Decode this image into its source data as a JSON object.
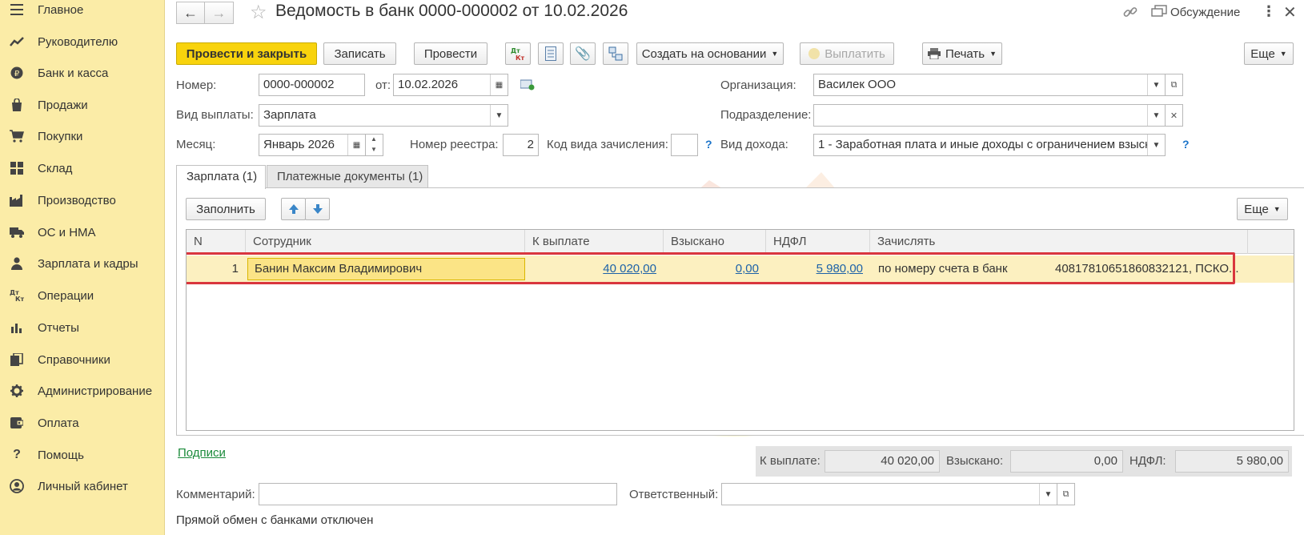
{
  "sidebar": {
    "items": [
      {
        "label": "Главное",
        "icon": "menu-icon"
      },
      {
        "label": "Руководителю",
        "icon": "chart-line-icon"
      },
      {
        "label": "Банк и касса",
        "icon": "coin-icon"
      },
      {
        "label": "Продажи",
        "icon": "shopping-bag-icon"
      },
      {
        "label": "Покупки",
        "icon": "cart-icon"
      },
      {
        "label": "Склад",
        "icon": "warehouse-icon"
      },
      {
        "label": "Производство",
        "icon": "factory-icon"
      },
      {
        "label": "ОС и НМА",
        "icon": "truck-icon"
      },
      {
        "label": "Зарплата и кадры",
        "icon": "person-icon"
      },
      {
        "label": "Операции",
        "icon": "dt-kt-icon"
      },
      {
        "label": "Отчеты",
        "icon": "bar-chart-icon"
      },
      {
        "label": "Справочники",
        "icon": "books-icon"
      },
      {
        "label": "Администрирование",
        "icon": "gear-icon"
      },
      {
        "label": "Оплата",
        "icon": "wallet-icon"
      },
      {
        "label": "Помощь",
        "icon": "question-icon"
      },
      {
        "label": "Личный кабинет",
        "icon": "user-circle-icon"
      }
    ]
  },
  "header": {
    "title": "Ведомость в банк 0000-000002 от 10.02.2026",
    "discussion_label": "Обсуждение"
  },
  "toolbar": {
    "post_close": "Провести и закрыть",
    "save": "Записать",
    "post": "Провести",
    "dtkt": "Дт Кт",
    "create_based": "Создать на основании",
    "pay": "Выплатить",
    "print": "Печать",
    "more": "Еще"
  },
  "form": {
    "number_label": "Номер:",
    "number_value": "0000-000002",
    "date_label": "от:",
    "date_value": "10.02.2026",
    "org_label": "Организация:",
    "org_value": "Василек ООО",
    "pay_type_label": "Вид выплаты:",
    "pay_type_value": "Зарплата",
    "division_label": "Подразделение:",
    "division_value": "",
    "month_label": "Месяц:",
    "month_value": "Январь 2026",
    "registry_label": "Номер реестра:",
    "registry_value": "2",
    "credit_code_label": "Код вида зачисления:",
    "credit_code_value": "",
    "income_type_label": "Вид дохода:",
    "income_type_value": "1 - Заработная плата и иные доходы с ограничением взыскания",
    "help": "?"
  },
  "tabs": [
    {
      "label": "Зарплата (1)"
    },
    {
      "label": "Платежные документы (1)"
    }
  ],
  "table_toolbar": {
    "fill": "Заполнить",
    "more": "Еще"
  },
  "table": {
    "columns": [
      "N",
      "Сотрудник",
      "К выплате",
      "Взыскано",
      "НДФЛ",
      "Зачислять"
    ],
    "rows": [
      {
        "n": "1",
        "employee": "Банин Максим Владимирович",
        "to_pay": "40 020,00",
        "collected": "0,00",
        "ndfl": "5 980,00",
        "credit_method": "по номеру счета в банк",
        "account": "40817810651860832121, ПСКО..."
      }
    ]
  },
  "signatures_link": "Подписи",
  "totals": {
    "to_pay_label": "К выплате:",
    "to_pay_value": "40 020,00",
    "collected_label": "Взыскано:",
    "collected_value": "0,00",
    "ndfl_label": "НДФЛ:",
    "ndfl_value": "5 980,00"
  },
  "footer": {
    "comment_label": "Комментарий:",
    "comment_value": "",
    "responsible_label": "Ответственный:",
    "responsible_value": "",
    "bank_exchange_note": "Прямой обмен с банками отключен"
  },
  "watermark": {
    "line1": "УЧЕТ",
    "line2": "БЕЗ ЗАБОТ"
  },
  "colors": {
    "sidebar_bg": "#fbeca7",
    "primary_button": "#f8d30d",
    "selected_row": "#fcf0c0",
    "highlight_border": "#d9363e",
    "link": "#1d62a8"
  }
}
